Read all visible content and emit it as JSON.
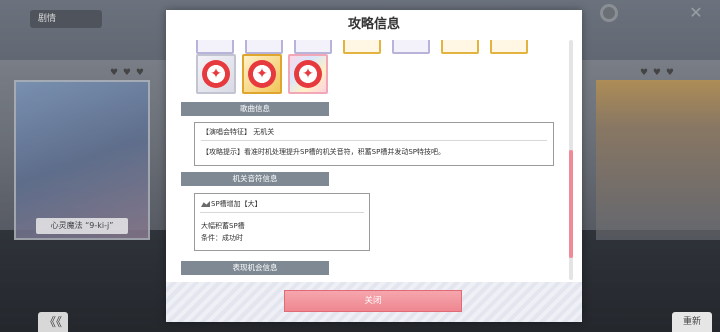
{
  "background": {
    "tab_label": "剧情",
    "card_label": "心灵魔法 “9-ki-j”",
    "hearts_left": "♥ ♥ ♥",
    "hearts_right": "♥ ♥ ♥",
    "back_label": "《《",
    "next_label": "重新",
    "close_glyph": "✕"
  },
  "dialog": {
    "title": "攻略信息",
    "partial_icon_count": 6,
    "skill_icons": [
      {
        "style": "silver",
        "glyph": "✦",
        "icon": "sp-skill-icon"
      },
      {
        "style": "gold",
        "glyph": "✦",
        "icon": "sp-skill-icon"
      },
      {
        "style": "rainbow",
        "glyph": "✦",
        "icon": "sp-skill-icon"
      }
    ],
    "song_section": {
      "heading": "歌曲信息",
      "feature_line": "【演唱会特征】 无机关",
      "hint_line": "【攻略提示】看准时机处理提升SP槽的机关音符，积蓄SP槽并发动SP特技吧。"
    },
    "gimmick_section": {
      "heading": "机关音符信息",
      "item_title": "SP槽增加【大】",
      "item_desc": "大幅积蓄SP槽",
      "item_condition": "条件：成功时"
    },
    "appeal_section": {
      "heading": "表现机会信息"
    },
    "close_button": "关闭"
  },
  "colors": {
    "accent_pink": "#ee8791",
    "section_header": "#7e8994",
    "scrollbar_thumb": "#f08a96"
  }
}
